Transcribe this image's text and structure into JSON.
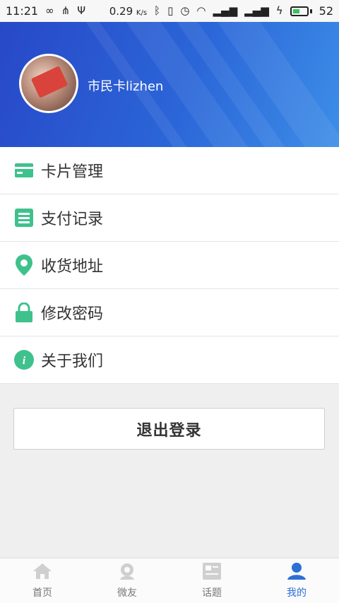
{
  "status_bar": {
    "time": "11:21",
    "net_speed": "0.29",
    "net_unit": "K/s",
    "battery": "52",
    "battery_level_percent": 52
  },
  "profile": {
    "username": "市民卡lizhen"
  },
  "menu": {
    "items": [
      {
        "label": "卡片管理",
        "icon": "card-icon"
      },
      {
        "label": "支付记录",
        "icon": "list-icon"
      },
      {
        "label": "收货地址",
        "icon": "location-pin-icon"
      },
      {
        "label": "修改密码",
        "icon": "lock-icon"
      },
      {
        "label": "关于我们",
        "icon": "info-icon"
      }
    ]
  },
  "logout": {
    "label": "退出登录"
  },
  "tabbar": {
    "tabs": [
      {
        "label": "首页",
        "icon": "home-icon",
        "active": false
      },
      {
        "label": "微友",
        "icon": "friends-icon",
        "active": false
      },
      {
        "label": "话题",
        "icon": "topic-icon",
        "active": false
      },
      {
        "label": "我的",
        "icon": "person-icon",
        "active": true
      }
    ]
  },
  "colors": {
    "accent": "#2c6fd6",
    "menu_icon": "#3fc18c",
    "header_start": "#2848c8",
    "header_end": "#3d8ee8"
  }
}
